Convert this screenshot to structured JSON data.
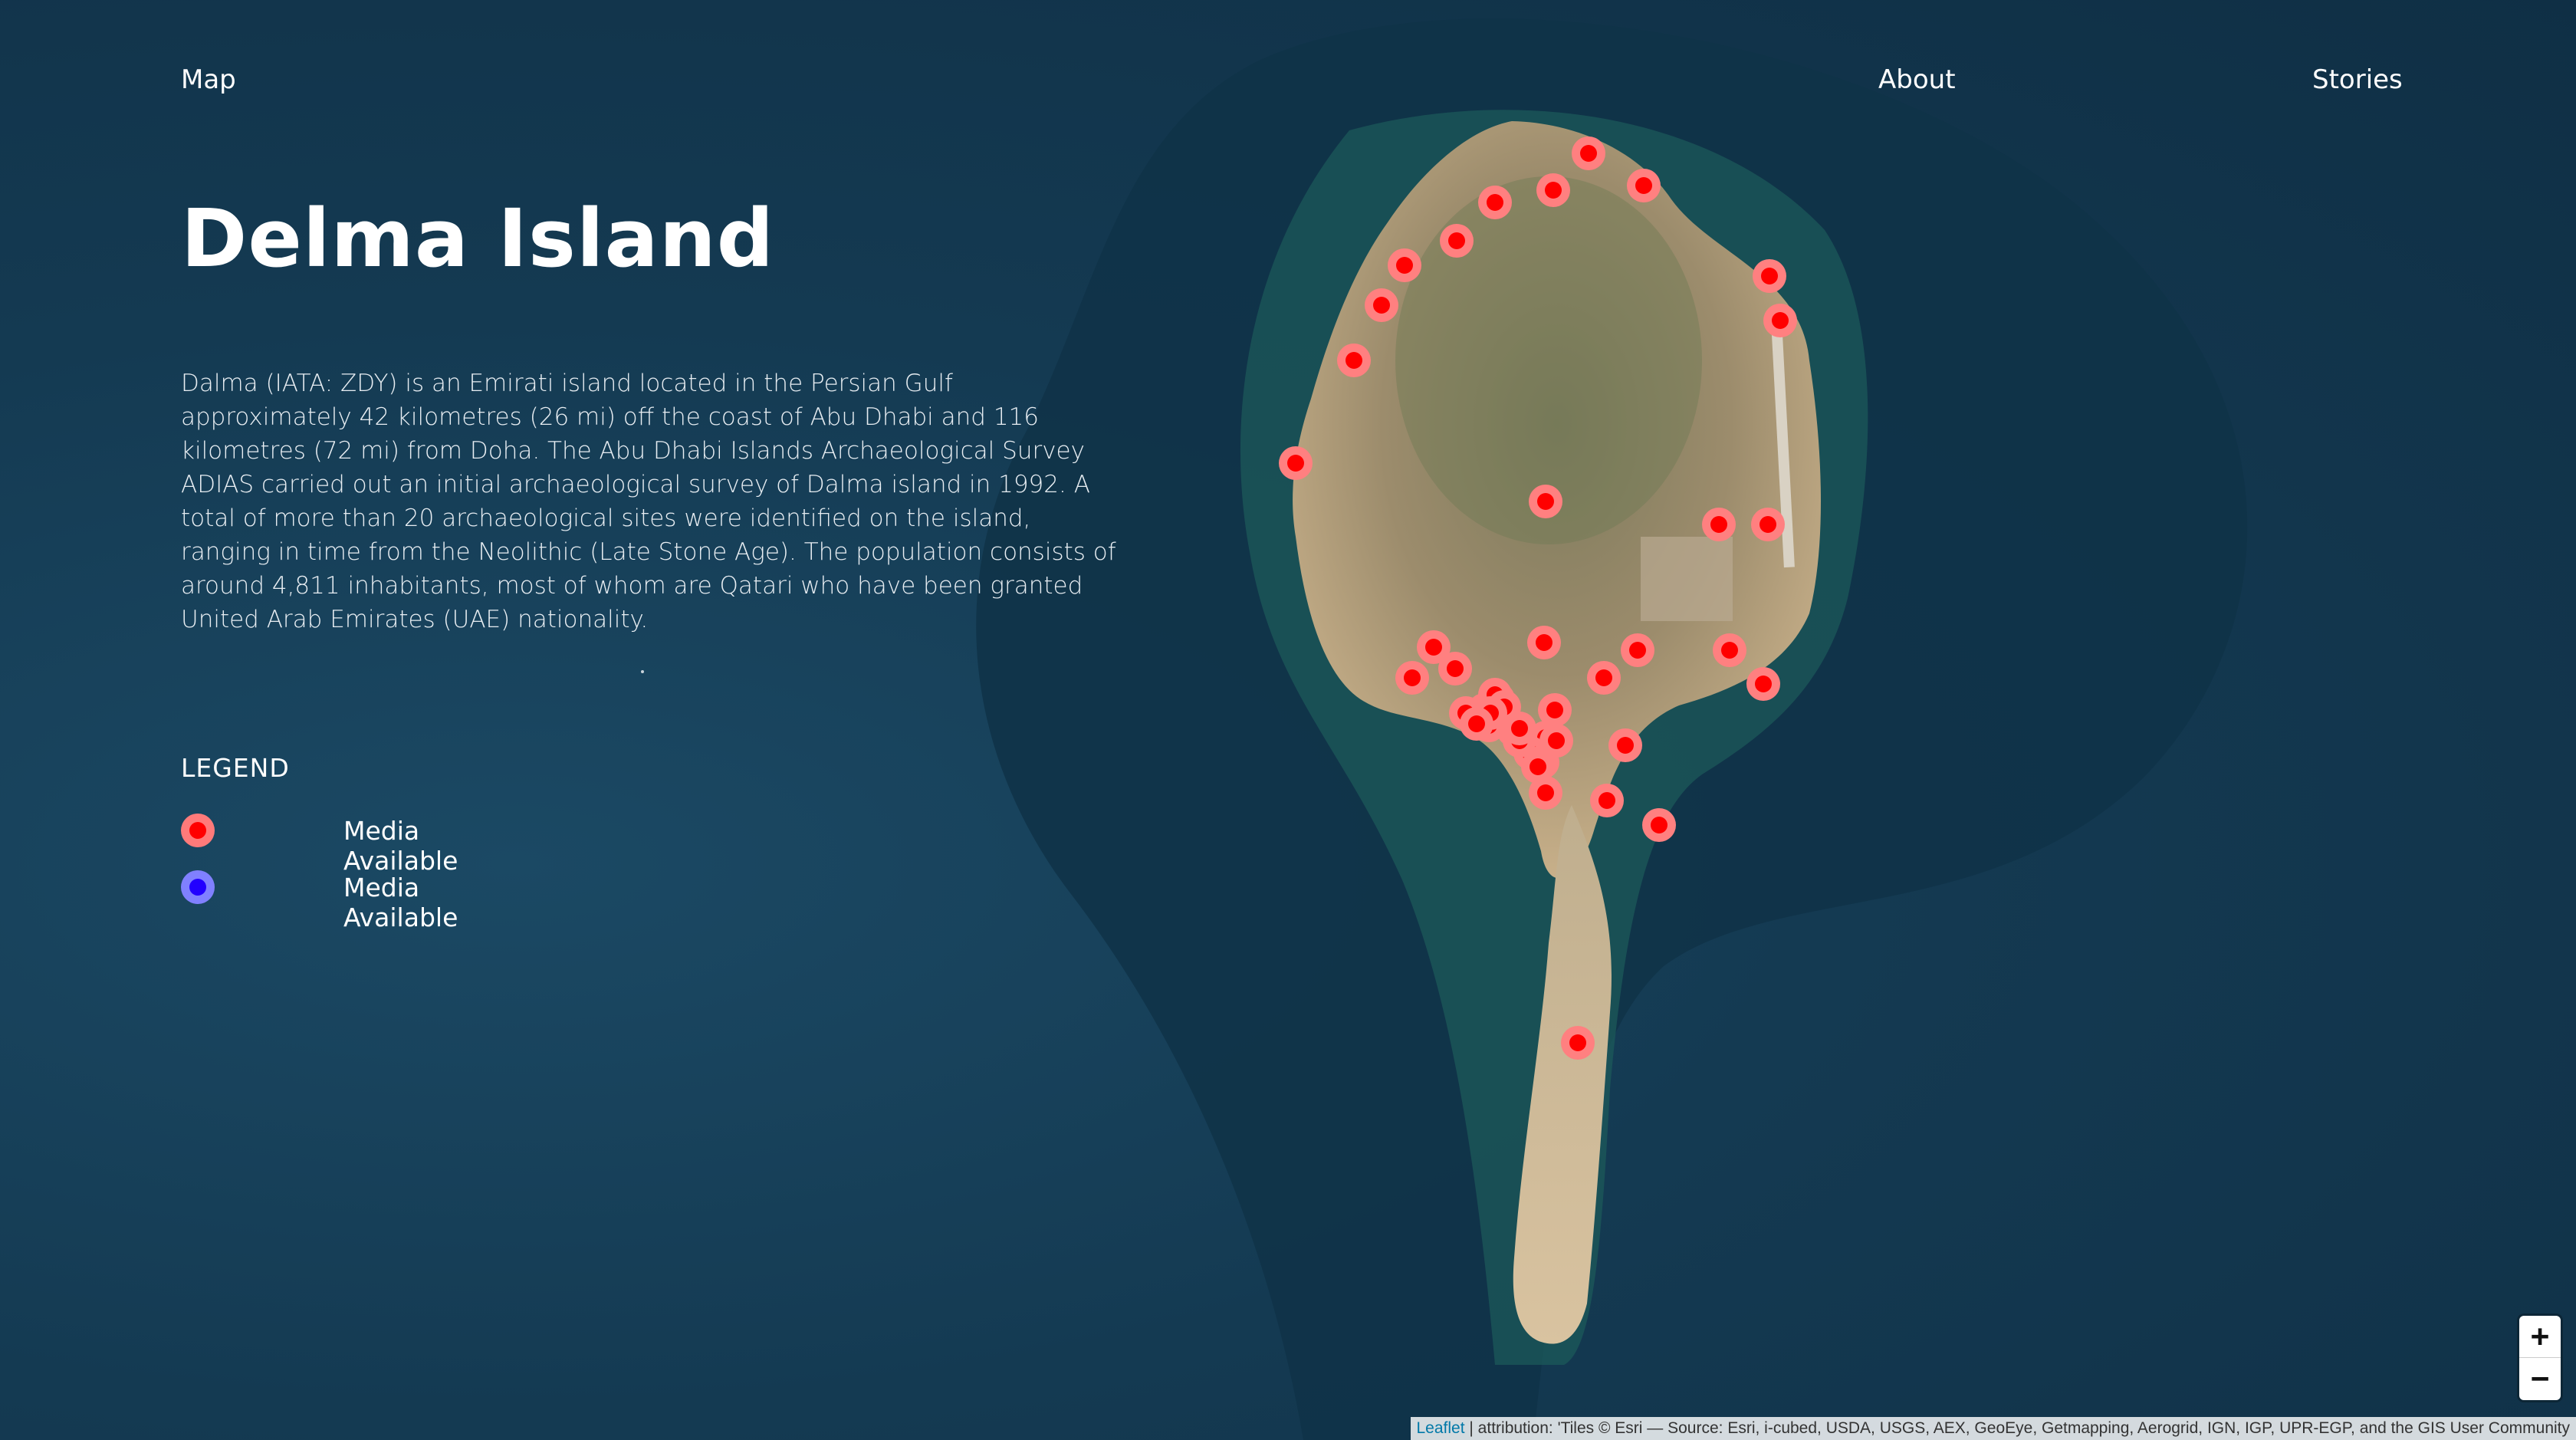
{
  "nav": {
    "map_label": "Map",
    "about_label": "About",
    "stories_label": "Stories"
  },
  "title": "Delma Island",
  "description": "Dalma (IATA: ZDY) is an Emirati island located in the Persian Gulf approximately 42 kilometres (26 mi) off the coast of Abu Dhabi and 116 kilometres (72 mi) from Doha. The Abu Dhabi Islands Archaeological Survey ADIAS carried out an initial archaeological survey of Dalma island in 1992. A total of more than 20 archaeological sites were identified on the island, ranging in time from the Neolithic (Late Stone Age). The population consists of around 4,811 inhabitants, most of whom are Qatari who have been granted United Arab Emirates (UAE) nationality.",
  "legend": {
    "title": "LEGEND",
    "items": [
      {
        "label": "Media Available",
        "color": "#ff0000",
        "ring": "#ff7a7a"
      },
      {
        "label": "Media Available",
        "color": "#2200ff",
        "ring": "#8080ff"
      }
    ]
  },
  "map": {
    "marker_color": "#ff0000",
    "marker_ring_color": "#ff8080",
    "marker_count": 46
  },
  "zoom": {
    "in_label": "+",
    "out_label": "−"
  },
  "attribution": {
    "leaflet": "Leaflet",
    "text": " | attribution: 'Tiles © Esri — Source: Esri, i-cubed, USDA, USGS, AEX, GeoEye, Getmapping, Aerogrid, IGN, IGP, UPR-EGP, and the GIS User Community"
  }
}
